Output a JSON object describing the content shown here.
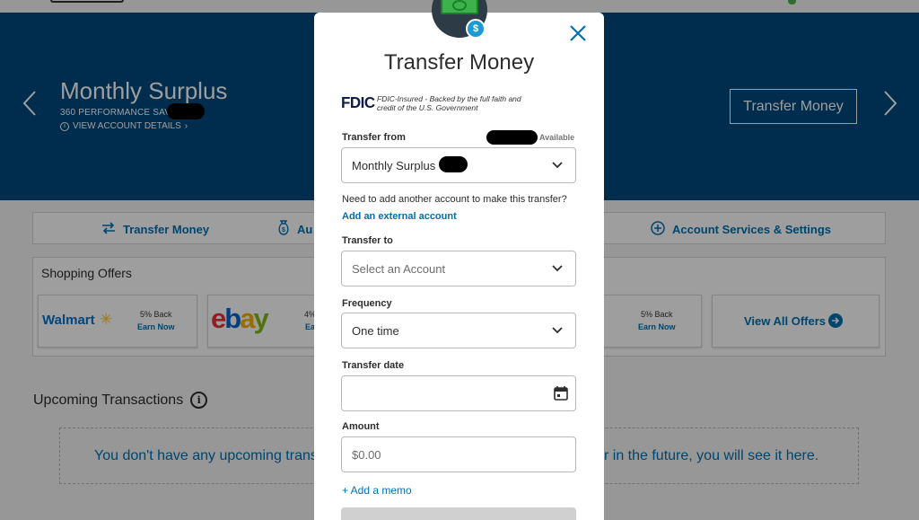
{
  "hero": {
    "account_name": "Monthly Surplus",
    "account_type": "360 PERFORMANCE SAVINGS",
    "view_details": "VIEW ACCOUNT DETAILS",
    "transfer_button": "Transfer Money"
  },
  "actions": {
    "transfer": "Transfer Money",
    "auto": "Au",
    "services": "Account Services & Settings"
  },
  "offers": {
    "title": "Shopping Offers",
    "cards": [
      {
        "merchant": "Walmart",
        "pct": "5% Back",
        "earn": "Earn Now"
      },
      {
        "merchant": "ebay",
        "pct": "4%",
        "earn": "Ear"
      },
      {
        "merchant": "",
        "pct": "5% Back",
        "earn": "Earn Now"
      }
    ],
    "view_all": "View All Offers"
  },
  "upcoming": {
    "title": "Upcoming Transactions",
    "text_left": "You don't have any upcoming trans",
    "text_right": "r in the future, you will see it here."
  },
  "modal": {
    "title": "Transfer Money",
    "fdic_logo": "FDIC",
    "fdic_text": "FDIC-Insured - Backed by the full faith and credit of the U.S. Government",
    "transfer_from_label": "Transfer from",
    "available_label": "Available",
    "transfer_from_value": "Monthly Surplus",
    "helper_text": "Need to add another account to make this transfer?",
    "add_external": "Add an external account",
    "transfer_to_label": "Transfer to",
    "transfer_to_placeholder": "Select an Account",
    "frequency_label": "Frequency",
    "frequency_value": "One time",
    "date_label": "Transfer date",
    "date_value": "",
    "amount_label": "Amount",
    "amount_placeholder": "$0.00",
    "add_memo": "+ Add a memo"
  },
  "colors": {
    "hero_bg": "#004a7c",
    "link": "#0070b0",
    "badge": "#1a9bd8"
  }
}
